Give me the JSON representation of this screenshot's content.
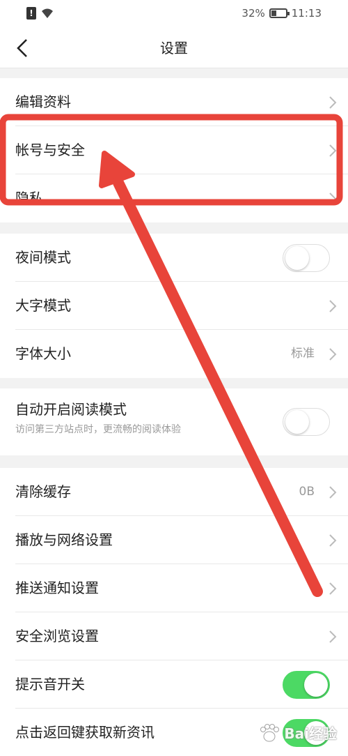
{
  "status_bar": {
    "battery": "32%",
    "time": "11:13"
  },
  "nav": {
    "title": "设置"
  },
  "group1": [
    {
      "label": "编辑资料"
    },
    {
      "label": "帐号与安全"
    },
    {
      "label": "隐私"
    }
  ],
  "group2": [
    {
      "label": "夜间模式",
      "toggle": false
    },
    {
      "label": "大字模式"
    },
    {
      "label": "字体大小",
      "value": "标准"
    }
  ],
  "group3": [
    {
      "label": "自动开启阅读模式",
      "sub": "访问第三方站点时，更流畅的阅读体验",
      "toggle": false
    }
  ],
  "group4": [
    {
      "label": "清除缓存",
      "value": "0B"
    },
    {
      "label": "播放与网络设置"
    },
    {
      "label": "推送通知设置"
    },
    {
      "label": "安全浏览设置"
    },
    {
      "label": "提示音开关",
      "toggle": true
    },
    {
      "label": "点击返回键获取新资讯"
    }
  ],
  "watermark": {
    "text": "Bai经验"
  },
  "colors": {
    "highlight": "#e8443a",
    "toggle_on": "#4cd964"
  }
}
